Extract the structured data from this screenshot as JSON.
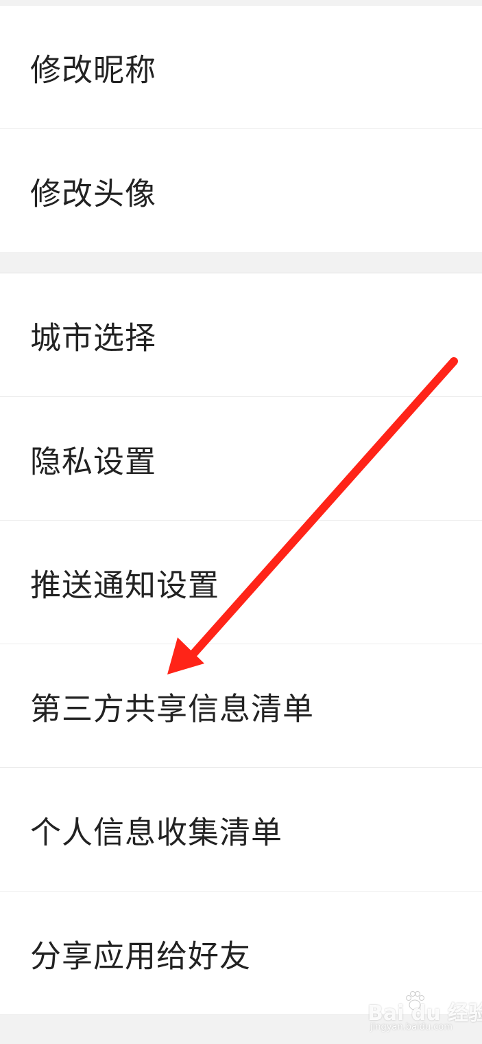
{
  "settings": {
    "group1": [
      {
        "label": "修改昵称"
      },
      {
        "label": "修改头像"
      }
    ],
    "group2": [
      {
        "label": "城市选择"
      },
      {
        "label": "隐私设置"
      },
      {
        "label": "推送通知设置"
      },
      {
        "label": "第三方共享信息清单"
      },
      {
        "label": "个人信息收集清单"
      },
      {
        "label": "分享应用给好友"
      }
    ]
  },
  "annotation": {
    "arrow_color": "#ff2418",
    "icon": "red-arrow-icon"
  },
  "watermark": {
    "logo_text": "Bai du 经验",
    "sub_text": "jingyan.baidu.com",
    "icon": "baidu-paw-icon"
  }
}
